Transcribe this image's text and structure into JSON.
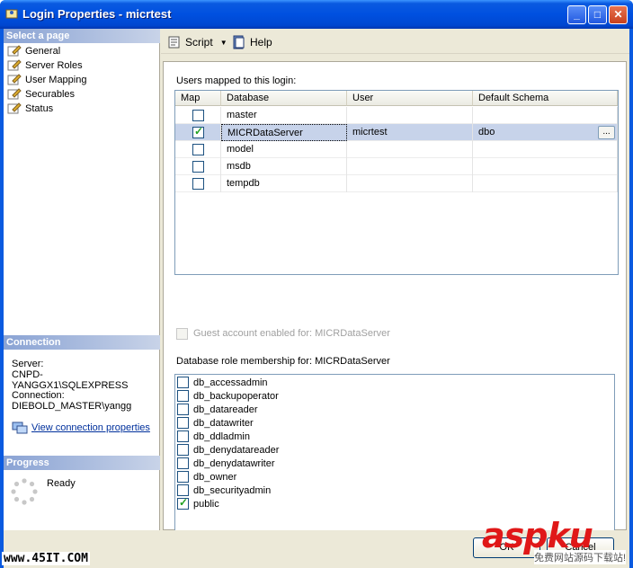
{
  "window": {
    "title": "Login Properties - micrtest"
  },
  "sidebar": {
    "header": "Select a page",
    "pages": [
      {
        "label": "General"
      },
      {
        "label": "Server Roles"
      },
      {
        "label": "User Mapping"
      },
      {
        "label": "Securables"
      },
      {
        "label": "Status"
      }
    ]
  },
  "connection": {
    "header": "Connection",
    "server_label": "Server:",
    "server_value": "CNPD-YANGGX1\\SQLEXPRESS",
    "connection_label": "Connection:",
    "connection_value": "DIEBOLD_MASTER\\yangg",
    "link": "View connection properties"
  },
  "progress": {
    "header": "Progress",
    "status": "Ready"
  },
  "toolbar": {
    "script": "Script",
    "help": "Help"
  },
  "mapping": {
    "label": "Users mapped to this login:",
    "columns": [
      "Map",
      "Database",
      "User",
      "Default Schema"
    ],
    "rows": [
      {
        "map": false,
        "database": "master",
        "user": "",
        "schema": ""
      },
      {
        "map": true,
        "database": "MICRDataServer",
        "user": "micrtest",
        "schema": "dbo",
        "selected": true
      },
      {
        "map": false,
        "database": "model",
        "user": "",
        "schema": ""
      },
      {
        "map": false,
        "database": "msdb",
        "user": "",
        "schema": ""
      },
      {
        "map": false,
        "database": "tempdb",
        "user": "",
        "schema": ""
      }
    ],
    "ellipsis": "..."
  },
  "guest": {
    "label": "Guest account enabled for: MICRDataServer",
    "checked": false,
    "enabled": false
  },
  "roles": {
    "label": "Database role membership for: MICRDataServer",
    "items": [
      {
        "name": "db_accessadmin",
        "checked": false
      },
      {
        "name": "db_backupoperator",
        "checked": false
      },
      {
        "name": "db_datareader",
        "checked": false
      },
      {
        "name": "db_datawriter",
        "checked": false
      },
      {
        "name": "db_ddladmin",
        "checked": false
      },
      {
        "name": "db_denydatareader",
        "checked": false
      },
      {
        "name": "db_denydatawriter",
        "checked": false
      },
      {
        "name": "db_owner",
        "checked": false
      },
      {
        "name": "db_securityadmin",
        "checked": false
      },
      {
        "name": "public",
        "checked": true
      }
    ]
  },
  "buttons": {
    "ok": "OK",
    "cancel": "Cancel"
  },
  "overlay": {
    "site": "www.45IT.COM",
    "brand": "aspku",
    "brand_sub": "免费网站源码下载站!"
  }
}
